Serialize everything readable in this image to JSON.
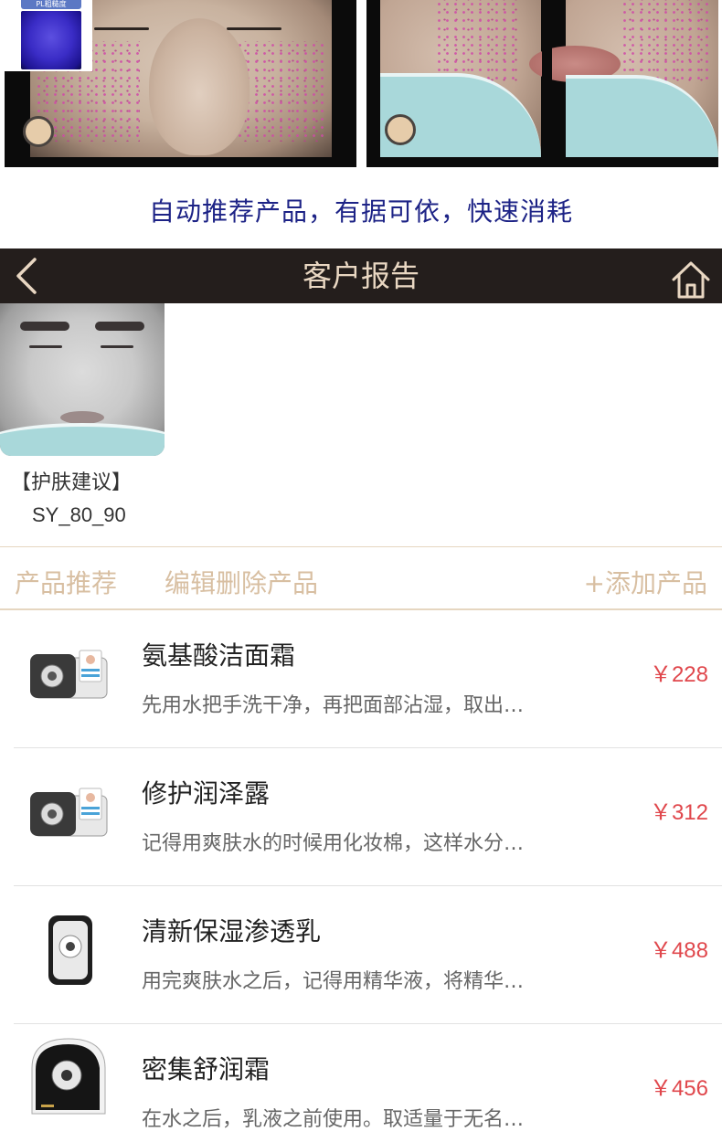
{
  "promo": {
    "uv_label": "PL粗糙度",
    "caption": "自动推荐产品，有据可依，快速消耗"
  },
  "header": {
    "title": "客户报告",
    "back_icon": "chevron-left-icon",
    "home_icon": "home-icon"
  },
  "report": {
    "advice_title": "【护肤建议】",
    "advice_code": "SY_80_90"
  },
  "tabs": {
    "recommend": "产品推荐",
    "edit": "编辑删除产品",
    "add": "+添加产品"
  },
  "products": [
    {
      "name": "氨基酸洁面霜",
      "desc": "先用水把手洗干净，再把面部沾湿，取出…",
      "price": "￥228",
      "image": "skin-analyzer-device-icon"
    },
    {
      "name": "修护润泽露",
      "desc": "记得用爽肤水的时候用化妆棉，这样水分…",
      "price": "￥312",
      "image": "skin-analyzer-device-icon"
    },
    {
      "name": "清新保湿渗透乳",
      "desc": "用完爽肤水之后，记得用精华液，将精华…",
      "price": "￥488",
      "image": "skin-analyzer-device-icon"
    },
    {
      "name": "密集舒润霜",
      "desc": "在水之后，乳液之前使用。取适量于无名…",
      "price": "￥456",
      "image": "skin-analyzer-device-icon"
    }
  ],
  "colors": {
    "header_bg": "#241e1c",
    "header_text": "#e9d7c2",
    "tab_text": "#d8bfa2",
    "price": "#e0474c",
    "caption": "#1d2386"
  }
}
